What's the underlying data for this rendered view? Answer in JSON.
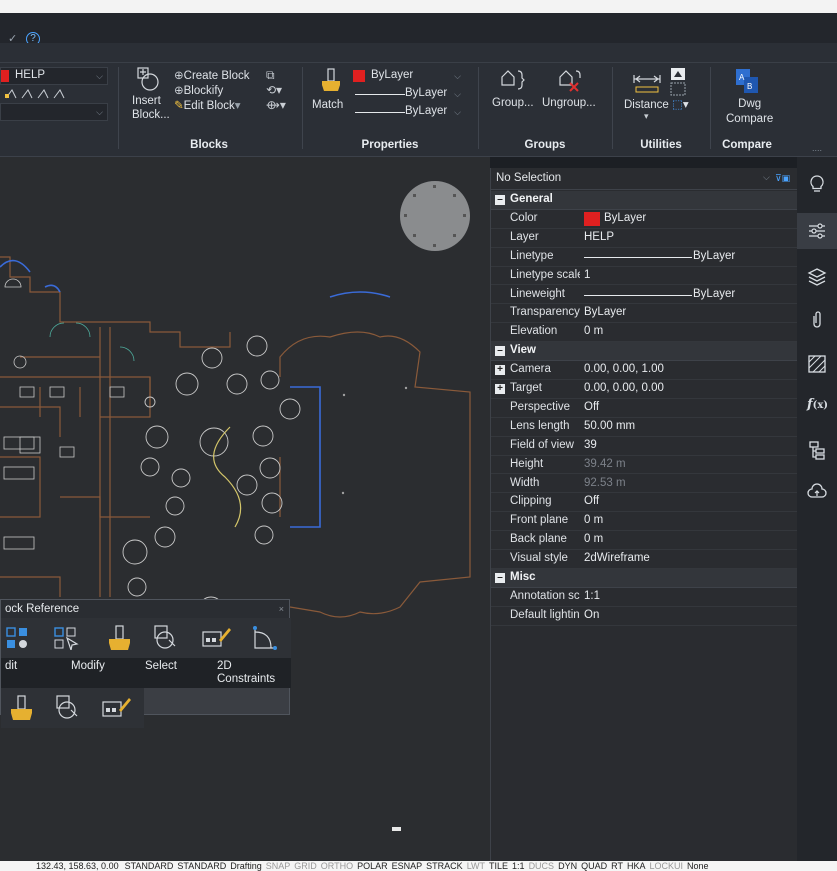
{
  "titlebar": {
    "help_icon": "?"
  },
  "ribbon": {
    "layer": {
      "name": "HELP"
    },
    "blocks": {
      "insert_label": "Insert\nBlock...",
      "create_block": "Create Block",
      "blockify": "Blockify",
      "edit_block": "Edit Block",
      "title": "Blocks"
    },
    "properties": {
      "match_label": "Match",
      "color": "ByLayer",
      "linetype": "ByLayer",
      "lineweight": "ByLayer",
      "title": "Properties"
    },
    "groups": {
      "group_label": "Group...",
      "ungroup_label": "Ungroup...",
      "title": "Groups"
    },
    "utilities": {
      "distance_label": "Distance",
      "title": "Utilities"
    },
    "compare": {
      "dwg_label": "Dwg\nCompare",
      "title": "Compare"
    }
  },
  "quad": {
    "title": "ock Reference",
    "labels": {
      "edit": "dit",
      "modify": "Modify",
      "select": "Select",
      "constraints": "2D\nConstraints"
    }
  },
  "properties_panel": {
    "selection": "No Selection",
    "sections": {
      "general": "General",
      "view": "View",
      "misc": "Misc"
    },
    "general": [
      {
        "name": "Color",
        "value": "ByLayer",
        "swatch": "#e02020"
      },
      {
        "name": "Layer",
        "value": "HELP"
      },
      {
        "name": "Linetype",
        "value": "ByLayer",
        "line": true
      },
      {
        "name": "Linetype scale",
        "value": "1"
      },
      {
        "name": "Lineweight",
        "value": "ByLayer",
        "line": true
      },
      {
        "name": "Transparency",
        "value": "ByLayer"
      },
      {
        "name": "Elevation",
        "value": "0 m"
      }
    ],
    "view": [
      {
        "name": "Camera",
        "value": "0.00, 0.00, 1.00",
        "expand": true
      },
      {
        "name": "Target",
        "value": "0.00, 0.00, 0.00",
        "expand": true
      },
      {
        "name": "Perspective",
        "value": "Off"
      },
      {
        "name": "Lens length",
        "value": "50.00 mm"
      },
      {
        "name": "Field of view",
        "value": "39"
      },
      {
        "name": "Height",
        "value": "39.42 m",
        "dim": true
      },
      {
        "name": "Width",
        "value": "92.53 m",
        "dim": true
      },
      {
        "name": "Clipping",
        "value": "Off"
      },
      {
        "name": "Front plane",
        "value": "0 m"
      },
      {
        "name": "Back plane",
        "value": "0 m"
      },
      {
        "name": "Visual style",
        "value": "2dWireframe"
      }
    ],
    "misc": [
      {
        "name": "Annotation scale",
        "value": "1:1"
      },
      {
        "name": "Default lighting",
        "value": "On"
      }
    ]
  },
  "statusbar": {
    "coords": "132.43, 158.63, 0.00",
    "items": [
      "STANDARD",
      "STANDARD",
      "Drafting",
      "SNAP",
      "GRID",
      "ORTHO",
      "POLAR",
      "ESNAP",
      "STRACK",
      "LWT",
      "TILE",
      "1:1",
      "DUCS",
      "DYN",
      "QUAD",
      "RT",
      "HKA",
      "LOCKUI",
      "None"
    ],
    "off_items": [
      "SNAP",
      "GRID",
      "ORTHO",
      "LWT",
      "DUCS",
      "LOCKUI"
    ]
  },
  "colors": {
    "background": "#1c1f24",
    "panel": "#2a2c30",
    "accent_red": "#e02020",
    "wall_brown": "#8a5a3a",
    "glass_blue": "#3a6bd8"
  }
}
